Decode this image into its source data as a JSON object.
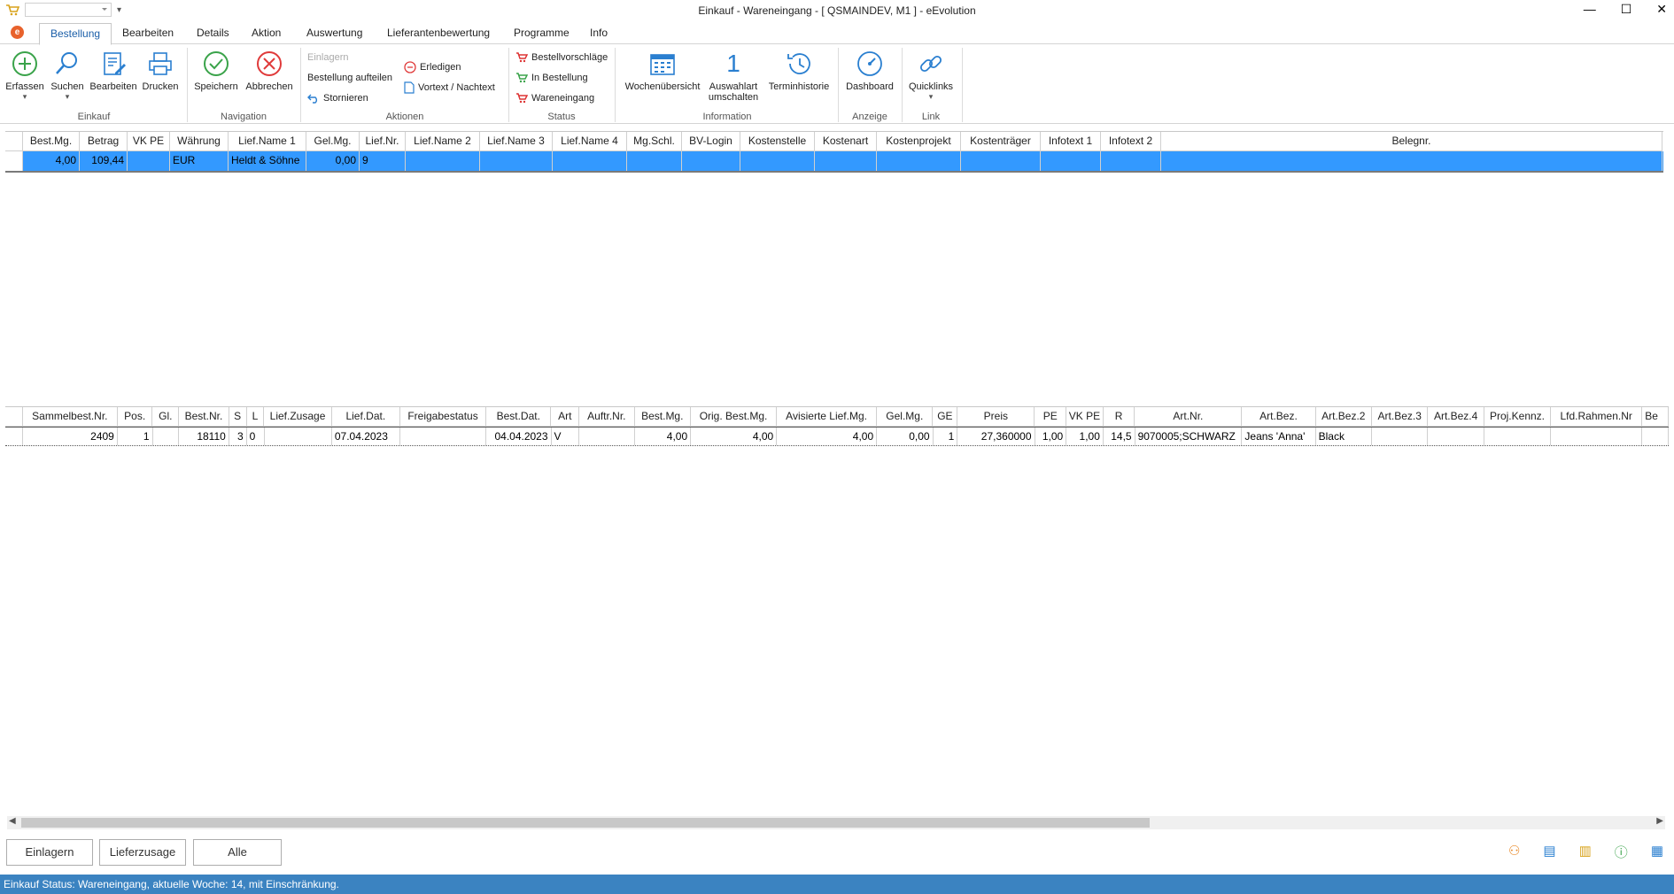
{
  "title": "Einkauf - Wareneingang - [ QSMAINDEV, M1 ]  -  eEvolution",
  "tabs": [
    "Bestellung",
    "Bearbeiten",
    "Details",
    "Aktion",
    "Auswertung",
    "Lieferantenbewertung",
    "Programme",
    "Info"
  ],
  "ribbon": {
    "einkauf": {
      "erfassen": "Erfassen",
      "suchen": "Suchen",
      "bearbeiten": "Bearbeiten",
      "drucken": "Drucken",
      "group": "Einkauf"
    },
    "navigation": {
      "speichern": "Speichern",
      "abbrechen": "Abbrechen",
      "group": "Navigation"
    },
    "aktionen": {
      "einlagern": "Einlagern",
      "aufteilen": "Bestellung aufteilen",
      "stornieren": "Stornieren",
      "erledigen": "Erledigen",
      "vortext": "Vortext / Nachtext",
      "group": "Aktionen"
    },
    "status": {
      "vorschlaege": "Bestellvorschläge",
      "in_bestellung": "In Bestellung",
      "wareneingang": "Wareneingang",
      "group": "Status"
    },
    "information": {
      "wochen": "Wochenübersicht",
      "auswahl1": "Auswahlart",
      "auswahl2": "umschalten",
      "termin": "Terminhistorie",
      "group": "Information"
    },
    "anzeige": {
      "dashboard": "Dashboard",
      "group": "Anzeige"
    },
    "link": {
      "quicklinks": "Quicklinks",
      "group": "Link"
    }
  },
  "grid1": {
    "headers": [
      "Best.Mg.",
      "Betrag",
      "VK PE",
      "Währung",
      "Lief.Name 1",
      "Gel.Mg.",
      "Lief.Nr.",
      "Lief.Name 2",
      "Lief.Name 3",
      "Lief.Name 4",
      "Mg.Schl.",
      "BV-Login",
      "Kostenstelle",
      "Kostenart",
      "Kostenprojekt",
      "Kostenträger",
      "Infotext 1",
      "Infotext 2",
      "Belegnr."
    ],
    "row": [
      "4,00",
      "109,44",
      "",
      "EUR",
      "Heldt & Söhne",
      "0,00",
      "9",
      "",
      "",
      "",
      "",
      "",
      "",
      "",
      "",
      "",
      "",
      "",
      ""
    ]
  },
  "grid2": {
    "headers": [
      "Sammelbest.Nr.",
      "Pos.",
      "Gl.",
      "Best.Nr.",
      "S",
      "L",
      "Lief.Zusage",
      "Lief.Dat.",
      "Freigabestatus",
      "Best.Dat.",
      "Art",
      "Auftr.Nr.",
      "Best.Mg.",
      "Orig. Best.Mg.",
      "Avisierte Lief.Mg.",
      "Gel.Mg.",
      "GE",
      "Preis",
      "PE",
      "VK PE",
      "R",
      "Art.Nr.",
      "Art.Bez.",
      "Art.Bez.2",
      "Art.Bez.3",
      "Art.Bez.4",
      "Proj.Kennz.",
      "Lfd.Rahmen.Nr",
      "Be"
    ],
    "row": [
      "2409",
      "1",
      "",
      "18110",
      "3",
      "0",
      "",
      "07.04.2023",
      "",
      "04.04.2023",
      "V",
      "",
      "4,00",
      "4,00",
      "4,00",
      "0,00",
      "1",
      "27,360000",
      "1,00",
      "1,00",
      "14,5",
      "9070005;SCHWARZ",
      "Jeans 'Anna'",
      "Black",
      "",
      "",
      "",
      "",
      ""
    ]
  },
  "buttons": {
    "einlagern": "Einlagern",
    "lieferzusage": "Lieferzusage",
    "alle": "Alle"
  },
  "status": "Einkauf Status: Wareneingang, aktuelle Woche: 14, mit Einschränkung."
}
